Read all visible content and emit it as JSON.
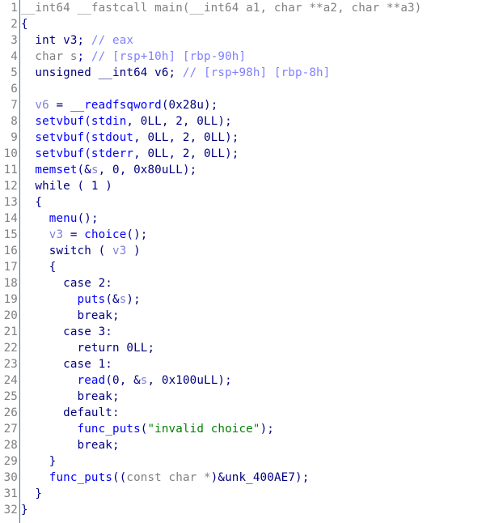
{
  "view": {
    "type": "IDA pseudocode view",
    "colors": {
      "gutter_line": "#2a7ac0",
      "line_number": "#808080",
      "keyword": "#000080",
      "function": "#0000ff",
      "variable": "#8080e0",
      "comment": "#8080ff",
      "gray": "#808080",
      "string": "#008000"
    }
  },
  "lines": [
    {
      "n": "1",
      "tokens": [
        {
          "t": "__int64 __fastcall main(__int64 a1, char **a2, char **a3)",
          "c": "gray"
        }
      ]
    },
    {
      "n": "2",
      "tokens": [
        {
          "t": "{",
          "c": "pun"
        }
      ]
    },
    {
      "n": "3",
      "tokens": [
        {
          "t": "  int v3; ",
          "c": "kw"
        },
        {
          "t": "// eax",
          "c": "cmt"
        }
      ]
    },
    {
      "n": "4",
      "tokens": [
        {
          "t": "  char s",
          "c": "gray"
        },
        {
          "t": "; ",
          "c": "kw"
        },
        {
          "t": "// [rsp+10h] [rbp-90h]",
          "c": "cmt"
        }
      ]
    },
    {
      "n": "5",
      "tokens": [
        {
          "t": "  unsigned __int64 v6; ",
          "c": "kw"
        },
        {
          "t": "// [rsp+98h] [rbp-8h]",
          "c": "cmt"
        }
      ]
    },
    {
      "n": "6",
      "tokens": [
        {
          "t": "",
          "c": "kw"
        }
      ]
    },
    {
      "n": "7",
      "tokens": [
        {
          "t": "  ",
          "c": "kw"
        },
        {
          "t": "v6",
          "c": "var"
        },
        {
          "t": " = ",
          "c": "kw"
        },
        {
          "t": "__readfsqword",
          "c": "fn"
        },
        {
          "t": "(0x28u);",
          "c": "kw"
        }
      ]
    },
    {
      "n": "8",
      "tokens": [
        {
          "t": "  ",
          "c": "kw"
        },
        {
          "t": "setvbuf(stdin",
          "c": "fn"
        },
        {
          "t": ", 0LL, 2, 0LL);",
          "c": "kw"
        }
      ]
    },
    {
      "n": "9",
      "tokens": [
        {
          "t": "  ",
          "c": "kw"
        },
        {
          "t": "setvbuf(stdout",
          "c": "fn"
        },
        {
          "t": ", 0LL, 2, 0LL);",
          "c": "kw"
        }
      ]
    },
    {
      "n": "10",
      "tokens": [
        {
          "t": "  ",
          "c": "kw"
        },
        {
          "t": "setvbuf(stderr",
          "c": "fn"
        },
        {
          "t": ", 0LL, 2, 0LL);",
          "c": "kw"
        }
      ]
    },
    {
      "n": "11",
      "tokens": [
        {
          "t": "  ",
          "c": "kw"
        },
        {
          "t": "memset",
          "c": "fn"
        },
        {
          "t": "(&",
          "c": "kw"
        },
        {
          "t": "s",
          "c": "var"
        },
        {
          "t": ", 0, 0x80uLL);",
          "c": "kw"
        }
      ]
    },
    {
      "n": "12",
      "tokens": [
        {
          "t": "  while ( 1 )",
          "c": "kw"
        }
      ]
    },
    {
      "n": "13",
      "tokens": [
        {
          "t": "  {",
          "c": "kw"
        }
      ]
    },
    {
      "n": "14",
      "tokens": [
        {
          "t": "    ",
          "c": "kw"
        },
        {
          "t": "menu",
          "c": "fn"
        },
        {
          "t": "();",
          "c": "kw"
        }
      ]
    },
    {
      "n": "15",
      "tokens": [
        {
          "t": "    ",
          "c": "kw"
        },
        {
          "t": "v3",
          "c": "var"
        },
        {
          "t": " = ",
          "c": "kw"
        },
        {
          "t": "choice",
          "c": "fn"
        },
        {
          "t": "();",
          "c": "kw"
        }
      ]
    },
    {
      "n": "16",
      "tokens": [
        {
          "t": "    switch ( ",
          "c": "kw"
        },
        {
          "t": "v3",
          "c": "var"
        },
        {
          "t": " )",
          "c": "kw"
        }
      ]
    },
    {
      "n": "17",
      "tokens": [
        {
          "t": "    {",
          "c": "kw"
        }
      ]
    },
    {
      "n": "18",
      "tokens": [
        {
          "t": "      case 2:",
          "c": "kw"
        }
      ]
    },
    {
      "n": "19",
      "tokens": [
        {
          "t": "        ",
          "c": "kw"
        },
        {
          "t": "puts",
          "c": "fn"
        },
        {
          "t": "(&",
          "c": "kw"
        },
        {
          "t": "s",
          "c": "var"
        },
        {
          "t": ");",
          "c": "kw"
        }
      ]
    },
    {
      "n": "20",
      "tokens": [
        {
          "t": "        break;",
          "c": "kw"
        }
      ]
    },
    {
      "n": "21",
      "tokens": [
        {
          "t": "      case 3:",
          "c": "kw"
        }
      ]
    },
    {
      "n": "22",
      "tokens": [
        {
          "t": "        return 0LL;",
          "c": "kw"
        }
      ]
    },
    {
      "n": "23",
      "tokens": [
        {
          "t": "      case 1:",
          "c": "kw"
        }
      ]
    },
    {
      "n": "24",
      "tokens": [
        {
          "t": "        ",
          "c": "kw"
        },
        {
          "t": "read",
          "c": "fn"
        },
        {
          "t": "(0, &",
          "c": "kw"
        },
        {
          "t": "s",
          "c": "var"
        },
        {
          "t": ", 0x100uLL);",
          "c": "kw"
        }
      ]
    },
    {
      "n": "25",
      "tokens": [
        {
          "t": "        break;",
          "c": "kw"
        }
      ]
    },
    {
      "n": "26",
      "tokens": [
        {
          "t": "      default:",
          "c": "kw"
        }
      ]
    },
    {
      "n": "27",
      "tokens": [
        {
          "t": "        ",
          "c": "kw"
        },
        {
          "t": "func_puts",
          "c": "fn"
        },
        {
          "t": "(",
          "c": "kw"
        },
        {
          "t": "\"invalid choice\"",
          "c": "str"
        },
        {
          "t": ");",
          "c": "kw"
        }
      ]
    },
    {
      "n": "28",
      "tokens": [
        {
          "t": "        break;",
          "c": "kw"
        }
      ]
    },
    {
      "n": "29",
      "tokens": [
        {
          "t": "    }",
          "c": "kw"
        }
      ]
    },
    {
      "n": "30",
      "tokens": [
        {
          "t": "    ",
          "c": "kw"
        },
        {
          "t": "func_puts",
          "c": "fn"
        },
        {
          "t": "((",
          "c": "kw"
        },
        {
          "t": "const char *",
          "c": "gray"
        },
        {
          "t": ")&unk_400AE7);",
          "c": "kw"
        }
      ]
    },
    {
      "n": "31",
      "tokens": [
        {
          "t": "  }",
          "c": "kw"
        }
      ]
    },
    {
      "n": "32",
      "tokens": [
        {
          "t": "}",
          "c": "kw"
        }
      ]
    }
  ]
}
